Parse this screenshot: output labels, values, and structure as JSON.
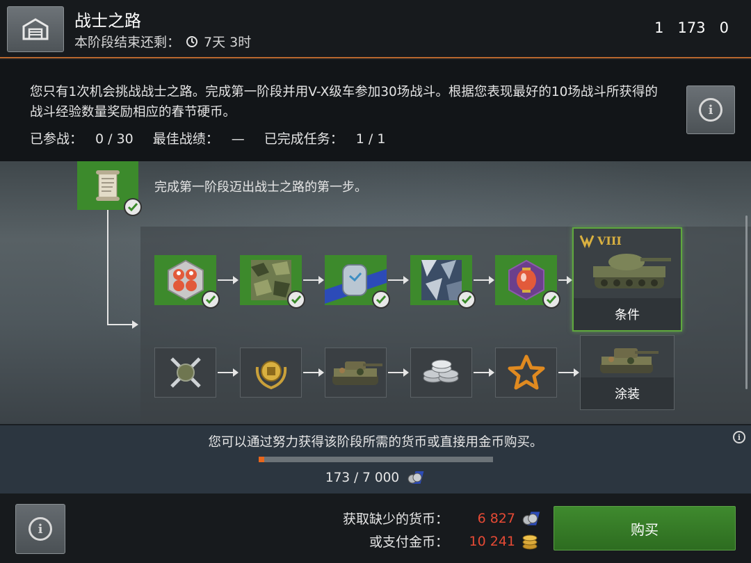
{
  "header": {
    "title": "战士之路",
    "timer_label": "本阶段结束还剩：",
    "timer_value": "7天 3时",
    "resources": [
      {
        "icon": "scroll-token-icon",
        "value": "1"
      },
      {
        "icon": "coins-currency-icon",
        "value": "173"
      },
      {
        "icon": "scroll-map-icon",
        "value": "0"
      }
    ]
  },
  "description": {
    "text": "您只有1次机会挑战战士之路。完成第一阶段并用V-X级车参加30场战斗。根据您表现最好的10场战斗所获得的战斗经验数量奖励相应的春节硬币。",
    "stats": [
      {
        "label": "已参战：",
        "value": "0 / 30"
      },
      {
        "label": "最佳战绩：",
        "value": "—"
      },
      {
        "label": "已完成任务：",
        "value": "1 / 1"
      }
    ]
  },
  "path": {
    "stage1_text": "完成第一阶段迈出战士之路的第一步。",
    "row1": [
      {
        "name": "lanterns-hex-icon",
        "completed": true
      },
      {
        "name": "camo-pattern-icon",
        "completed": true
      },
      {
        "name": "dog-tag-icon",
        "completed": true
      },
      {
        "name": "shard-pattern-icon",
        "completed": true
      },
      {
        "name": "lantern-hex-icon",
        "completed": true
      }
    ],
    "row1_reward": {
      "tier": "VIII",
      "label": "条件"
    },
    "row2": [
      {
        "name": "crossed-tools-icon"
      },
      {
        "name": "gold-emblem-icon"
      },
      {
        "name": "camo-tank-icon"
      },
      {
        "name": "silver-stack-icon"
      },
      {
        "name": "gold-star-icon"
      }
    ],
    "row2_reward": {
      "label": "涂装"
    }
  },
  "purchase": {
    "text": "您可以通过努力获得该阶段所需的货币或直接用金币购买。",
    "progress_current": 173,
    "progress_total": 7000,
    "progress_text": "173 / 7 000"
  },
  "footer": {
    "missing_label": "获取缺少的货币：",
    "missing_value": "6 827",
    "gold_label": "或支付金币：",
    "gold_value": "10 241",
    "buy_label": "购买"
  },
  "colors": {
    "accent_orange": "#e8661c",
    "green": "#3d8a2c",
    "price_red": "#e64a35"
  }
}
